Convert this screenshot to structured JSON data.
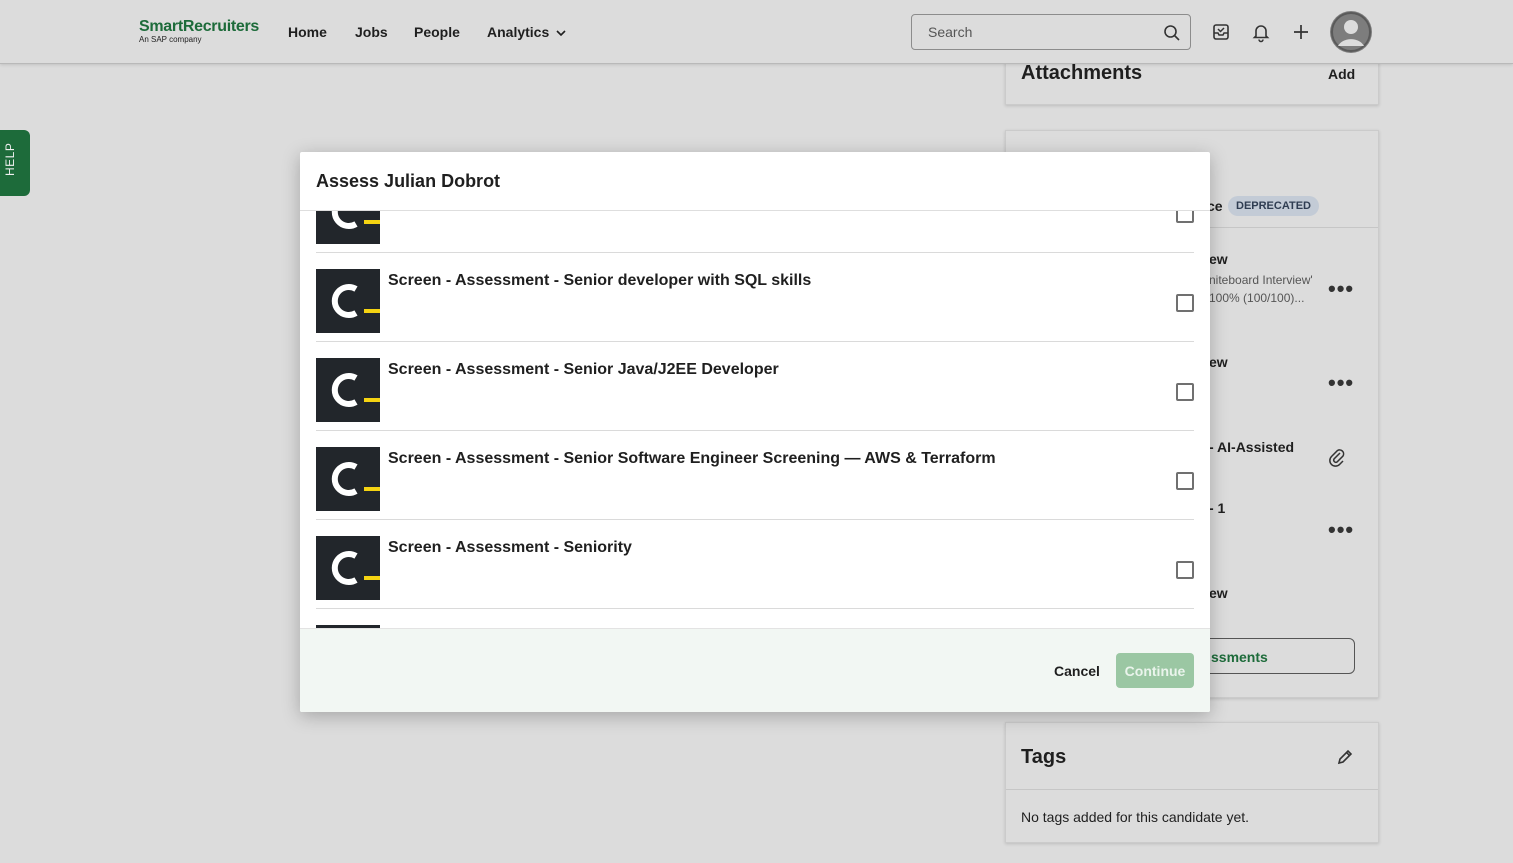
{
  "brand": {
    "name": "SmartRecruiters",
    "tagline": "An SAP company"
  },
  "nav": {
    "home": "Home",
    "jobs": "Jobs",
    "people": "People",
    "analytics": "Analytics"
  },
  "search": {
    "placeholder": "Search"
  },
  "help": {
    "label": "HELP"
  },
  "background": {
    "attachments": {
      "title": "Attachments",
      "add": "Add"
    },
    "assessments": {
      "partial_text": "ce",
      "badge": "DEPRECATED",
      "item1": "ew",
      "item1_detail_1": "niteboard Interview'",
      "item1_detail_2": "100% (100/100)...",
      "item2": "ew",
      "item3": "- AI-Assisted",
      "item4": "- 1",
      "item5": "ew",
      "button": "ssments"
    },
    "tags": {
      "title": "Tags",
      "empty": "No tags added for this candidate yet."
    }
  },
  "modal": {
    "title": "Assess Julian Dobrot",
    "items": [
      {
        "label": ""
      },
      {
        "label": "Screen - Assessment - Senior developer with SQL skills"
      },
      {
        "label": "Screen - Assessment - Senior Java/J2EE Developer"
      },
      {
        "label": "Screen - Assessment - Senior Software Engineer Screening — AWS & Terraform"
      },
      {
        "label": "Screen - Assessment - Seniority"
      },
      {
        "label": ""
      }
    ],
    "cancel": "Cancel",
    "continue": "Continue"
  },
  "colors": {
    "brand_green": "#1d6b3a",
    "continue_disabled": "#9bc7a3",
    "logo_yellow": "#f5d312",
    "logo_dark": "#22262b"
  }
}
